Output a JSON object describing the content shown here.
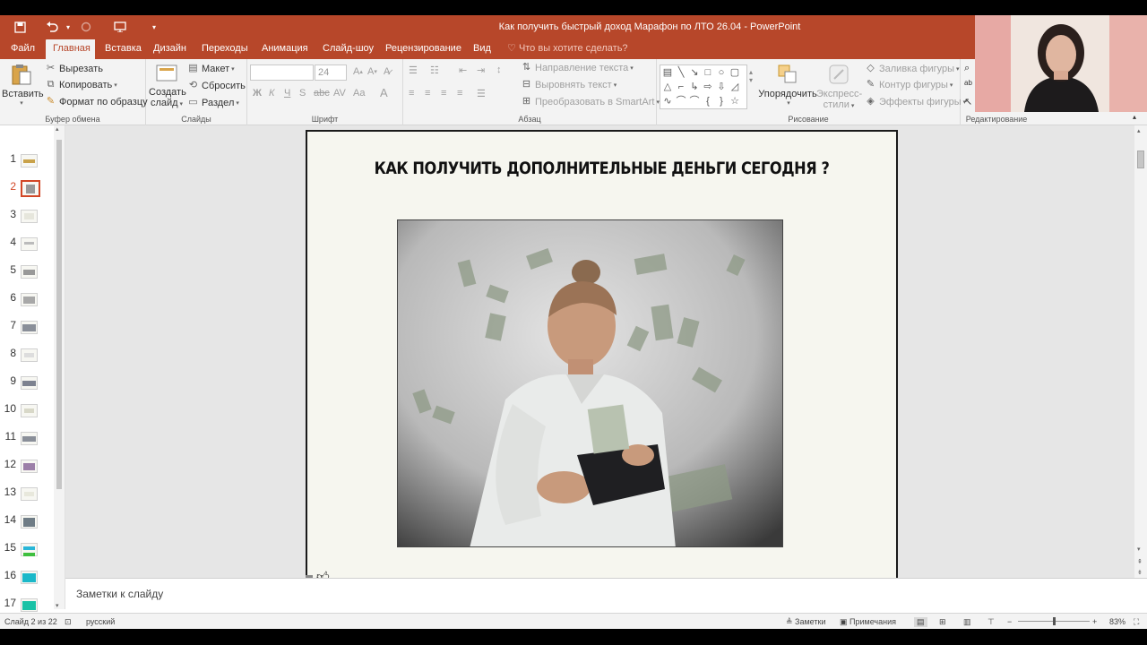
{
  "app": {
    "title": "Как получить быстрый доход Марафон по ЛТО 26.04 - PowerPoint"
  },
  "colors": {
    "accent": "#b7472a",
    "ribbon": "#f3f3f3",
    "active_thumb": "#d24726"
  },
  "tabs": [
    {
      "label": "Файл"
    },
    {
      "label": "Главная",
      "active": true
    },
    {
      "label": "Вставка"
    },
    {
      "label": "Дизайн"
    },
    {
      "label": "Переходы"
    },
    {
      "label": "Анимация"
    },
    {
      "label": "Слайд-шоу"
    },
    {
      "label": "Рецензирование"
    },
    {
      "label": "Вид"
    }
  ],
  "tell_me": "Что вы хотите сделать?",
  "ribbon": {
    "clipboard": {
      "label": "Буфер обмена",
      "paste": "Вставить",
      "cut": "Вырезать",
      "copy": "Копировать",
      "format_painter": "Формат по образцу"
    },
    "slides": {
      "label": "Слайды",
      "new_slide_1": "Создать",
      "new_slide_2": "слайд",
      "layout": "Макет",
      "reset": "Сбросить",
      "section": "Раздел"
    },
    "font": {
      "label": "Шрифт",
      "size": "24"
    },
    "paragraph": {
      "label": "Абзац",
      "text_direction": "Направление текста",
      "align_text": "Выровнять текст",
      "smartart": "Преобразовать в SmartArt"
    },
    "drawing": {
      "label": "Рисование",
      "arrange": "Упорядочить",
      "quick_styles_1": "Экспресс-",
      "quick_styles_2": "стили",
      "shape_fill": "Заливка фигуры",
      "shape_outline": "Контур фигуры",
      "shape_effects": "Эффекты фигуры"
    },
    "editing": {
      "label": "Редактирование"
    }
  },
  "thumbnails": [
    {
      "num": "1"
    },
    {
      "num": "2",
      "active": true
    },
    {
      "num": "3"
    },
    {
      "num": "4"
    },
    {
      "num": "5"
    },
    {
      "num": "6"
    },
    {
      "num": "7"
    },
    {
      "num": "8"
    },
    {
      "num": "9"
    },
    {
      "num": "10"
    },
    {
      "num": "11"
    },
    {
      "num": "12"
    },
    {
      "num": "13"
    },
    {
      "num": "14"
    },
    {
      "num": "15"
    },
    {
      "num": "16"
    },
    {
      "num": "17"
    }
  ],
  "slide": {
    "title": "КАК ПОЛУЧИТЬ ДОПОЛНИТЕЛЬНЫЕ ДЕНЬГИ  СЕГОДНЯ ?"
  },
  "notes": {
    "placeholder": "Заметки к слайду"
  },
  "status": {
    "slide_counter": "Слайд 2 из 22",
    "language": "русский",
    "notes": "Заметки",
    "comments": "Примечания",
    "zoom": "83%",
    "zoom_level": 0.5
  }
}
